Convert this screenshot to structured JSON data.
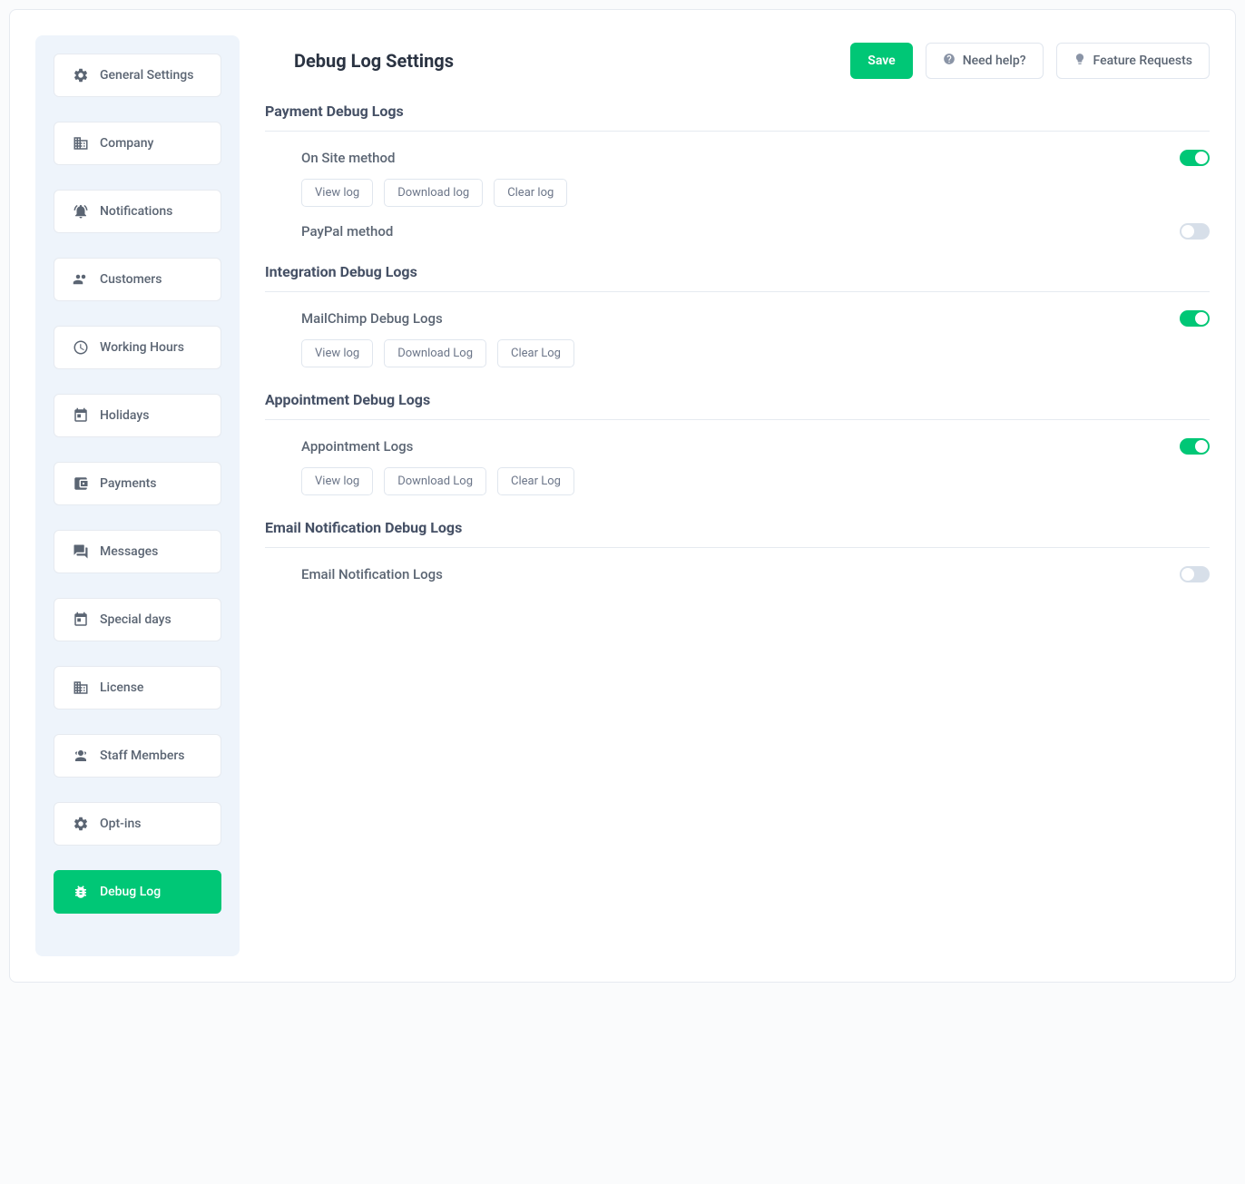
{
  "page": {
    "title": "Debug Log Settings"
  },
  "header": {
    "save_label": "Save",
    "help_label": "Need help?",
    "feature_label": "Feature Requests"
  },
  "sidebar": {
    "items": [
      {
        "label": "General Settings",
        "icon": "gear",
        "active": false
      },
      {
        "label": "Company",
        "icon": "building",
        "active": false
      },
      {
        "label": "Notifications",
        "icon": "bell",
        "active": false
      },
      {
        "label": "Customers",
        "icon": "people",
        "active": false
      },
      {
        "label": "Working Hours",
        "icon": "clock",
        "active": false
      },
      {
        "label": "Holidays",
        "icon": "calendar",
        "active": false
      },
      {
        "label": "Payments",
        "icon": "wallet",
        "active": false
      },
      {
        "label": "Messages",
        "icon": "chat",
        "active": false
      },
      {
        "label": "Special days",
        "icon": "calendar",
        "active": false
      },
      {
        "label": "License",
        "icon": "building",
        "active": false
      },
      {
        "label": "Staff Members",
        "icon": "group",
        "active": false
      },
      {
        "label": "Opt-ins",
        "icon": "gear",
        "active": false
      },
      {
        "label": "Debug Log",
        "icon": "bug",
        "active": true
      }
    ]
  },
  "sections": [
    {
      "title": "Payment Debug Logs",
      "items": [
        {
          "title": "On Site method",
          "enabled": true,
          "actions": [
            "View log",
            "Download log",
            "Clear log"
          ]
        },
        {
          "title": "PayPal method",
          "enabled": false,
          "actions": []
        }
      ]
    },
    {
      "title": "Integration Debug Logs",
      "items": [
        {
          "title": "MailChimp Debug Logs",
          "enabled": true,
          "actions": [
            "View log",
            "Download Log",
            "Clear Log"
          ]
        }
      ]
    },
    {
      "title": "Appointment Debug Logs",
      "items": [
        {
          "title": "Appointment Logs",
          "enabled": true,
          "actions": [
            "View log",
            "Download Log",
            "Clear Log"
          ]
        }
      ]
    },
    {
      "title": "Email Notification Debug Logs",
      "items": [
        {
          "title": "Email Notification Logs",
          "enabled": false,
          "actions": []
        }
      ]
    }
  ]
}
